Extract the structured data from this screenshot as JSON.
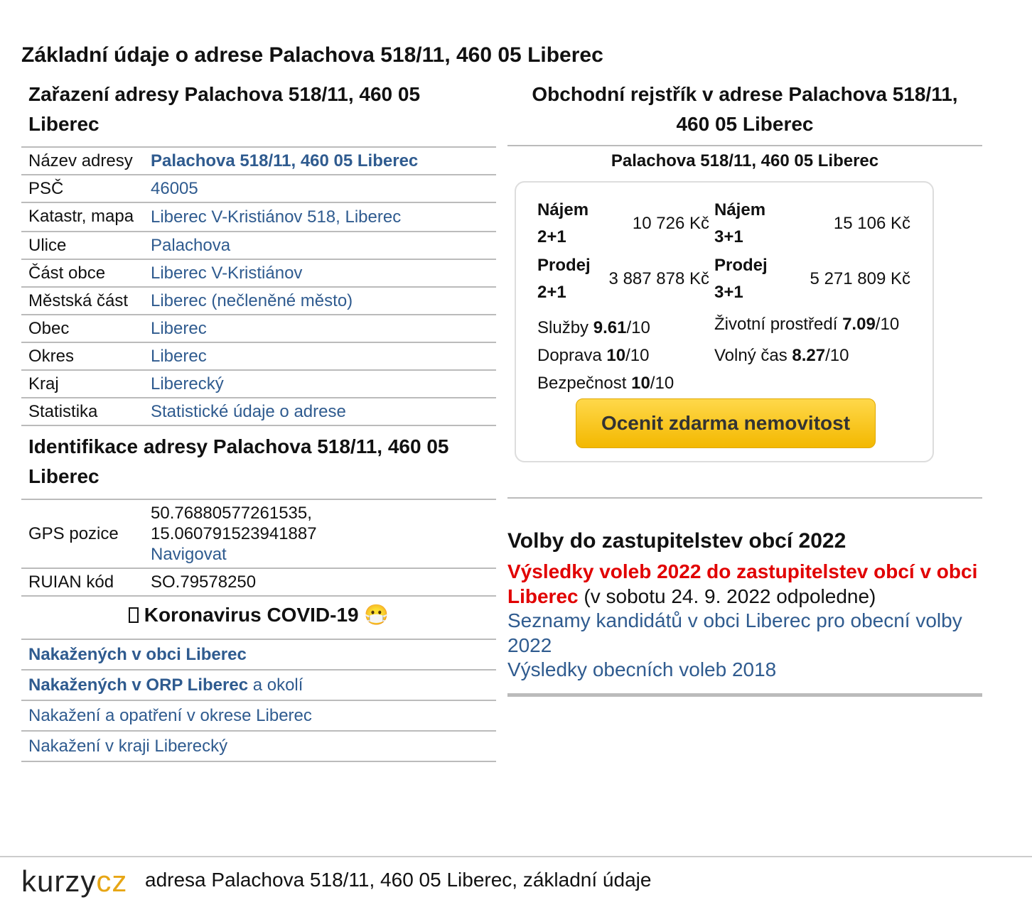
{
  "page_title": "Základní údaje o adrese Palachova 518/11, 460 05 Liberec",
  "zarazeni": {
    "heading": "Zařazení adresy Palachova 518/11, 460 05 Liberec",
    "rows": [
      {
        "key": "Název adresy",
        "value": "Palachova 518/11, 460 05 Liberec"
      },
      {
        "key": "PSČ",
        "value": "46005"
      },
      {
        "key": "Katastr, mapa",
        "value": "Liberec V-Kristiánov 518, Liberec"
      },
      {
        "key": "Ulice",
        "value": "Palachova"
      },
      {
        "key": "Část obce",
        "value": "Liberec V-Kristiánov"
      },
      {
        "key": "Městská část",
        "value": "Liberec (nečleněné město)"
      },
      {
        "key": "Obec",
        "value": "Liberec"
      },
      {
        "key": "Okres",
        "value": "Liberec"
      },
      {
        "key": "Kraj",
        "value": "Liberecký"
      },
      {
        "key": "Statistika",
        "value": "Statistické údaje o adrese"
      }
    ]
  },
  "identifikace": {
    "heading": "Identifikace adresy Palachova 518/11, 460 05 Liberec",
    "gps_label": "GPS pozice",
    "gps_lat": "50.76880577261535,",
    "gps_lon": "15.060791523941887",
    "navigate": "Navigovat",
    "ruian_label": "RUIAN kód",
    "ruian_value": "SO.79578250"
  },
  "covid": {
    "heading": "Koronavirus COVID-19",
    "heading_icon": "microbe-icon",
    "mask_icon": "face-with-mask-icon",
    "links": [
      {
        "bold": "Nakažených v obci Liberec",
        "rest": ""
      },
      {
        "bold": "Nakažených v ORP Liberec",
        "rest": " a okolí"
      },
      {
        "bold": "",
        "rest": "Nakažení a opatření v okrese Liberec"
      },
      {
        "bold": "",
        "rest": "Nakažení v kraji Liberecký"
      }
    ]
  },
  "rejstrik": {
    "heading": "Obchodní rejstřík v adrese Palachova 518/11, 460 05 Liberec",
    "address": "Palachova 518/11, 460 05 Liberec",
    "prices": [
      {
        "label": "Nájem 2+1",
        "value": "10 726 Kč"
      },
      {
        "label": "Nájem 3+1",
        "value": "15 106 Kč"
      },
      {
        "label": "Prodej 2+1",
        "value": "3 887 878 Kč"
      },
      {
        "label": "Prodej 3+1",
        "value": "5 271 809 Kč"
      }
    ],
    "scores": [
      {
        "name": "Služby",
        "score": "9.61",
        "max": "/10"
      },
      {
        "name": "Životní prostředí",
        "score": "7.09",
        "max": "/10"
      },
      {
        "name": "Doprava",
        "score": "10",
        "max": "/10"
      },
      {
        "name": "Volný čas",
        "score": "8.27",
        "max": "/10"
      },
      {
        "name": "Bezpečnost",
        "score": "10",
        "max": "/10"
      }
    ],
    "cta": "Ocenit zdarma nemovitost"
  },
  "volby": {
    "heading": "Volby do zastupitelstev obcí 2022",
    "results_link": "Výsledky voleb 2022 do zastupitelstev obcí v obci Liberec",
    "results_note": " (v sobotu 24. 9. 2022 odpoledne)",
    "candidates_link": "Seznamy kandidátů v obci Liberec pro obecní volby 2022",
    "results_2018": "Výsledky obecních voleb 2018"
  },
  "footer": {
    "logo_a": "kurzy",
    "logo_b": "cz",
    "text": "adresa Palachova 518/11, 460 05 Liberec, základní údaje"
  },
  "colors": {
    "link": "#2f5b8f",
    "red": "#e10000",
    "cta": "#f3b800",
    "logo_accent": "#e7a615"
  }
}
